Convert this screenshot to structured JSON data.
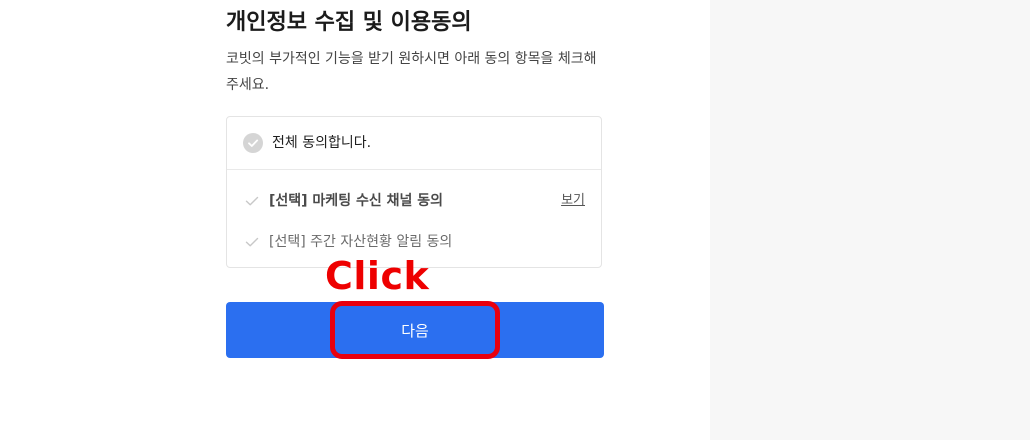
{
  "consent": {
    "title": "개인정보 수집 및 이용동의",
    "description": "코빗의 부가적인 기능을 받기 원하시면 아래 동의 항목을 체크해 주세요.",
    "agree_all_label": "전체 동의합니다.",
    "options": [
      {
        "label": "[선택] 마케팅 수신 채널 동의",
        "link_label": "보기"
      },
      {
        "label": "[선택] 주간 자산현황 알림 동의"
      }
    ],
    "next_button_label": "다음"
  },
  "annotation": {
    "text": "Click",
    "color": "#ee0000"
  },
  "colors": {
    "primary_button": "#2b6ff0",
    "highlight_border": "#e8000e",
    "side_panel": "#f7f7f7"
  }
}
